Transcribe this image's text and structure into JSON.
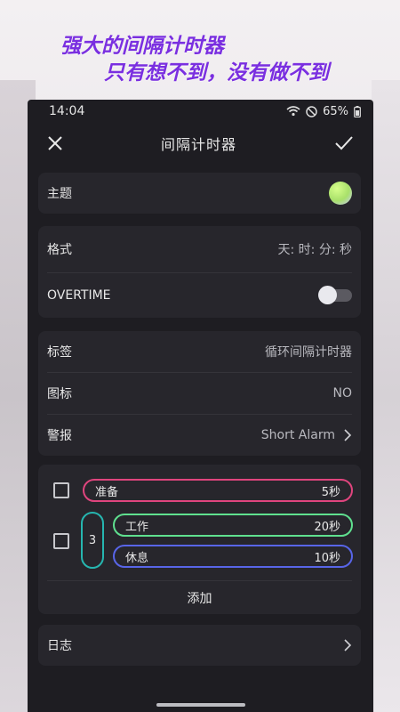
{
  "promo": {
    "line1": "强大的间隔计时器",
    "line2": "只有想不到，没有做不到"
  },
  "status": {
    "time": "14:04",
    "battery": "65%"
  },
  "topbar": {
    "title": "间隔计时器"
  },
  "theme": {
    "label": "主题"
  },
  "format": {
    "label": "格式",
    "value": "天: 时: 分: 秒",
    "overtime_label": "OVERTIME",
    "overtime_on": false
  },
  "settings": {
    "tag_label": "标签",
    "tag_value": "循环间隔计时器",
    "icon_label": "图标",
    "icon_value": "NO",
    "alarm_label": "警报",
    "alarm_value": "Short Alarm"
  },
  "intervals": {
    "prepare": {
      "name": "准备",
      "duration": "5秒",
      "color": "#e0457e"
    },
    "loop_count": "3",
    "work": {
      "name": "工作",
      "duration": "20秒",
      "color": "#5fe08f"
    },
    "rest": {
      "name": "休息",
      "duration": "10秒",
      "color": "#5865e8"
    },
    "add_label": "添加"
  },
  "log": {
    "label": "日志"
  },
  "icons": [
    "close-icon",
    "check-icon",
    "wifi-icon",
    "dnd-icon",
    "battery-icon",
    "chevron-right-icon"
  ]
}
